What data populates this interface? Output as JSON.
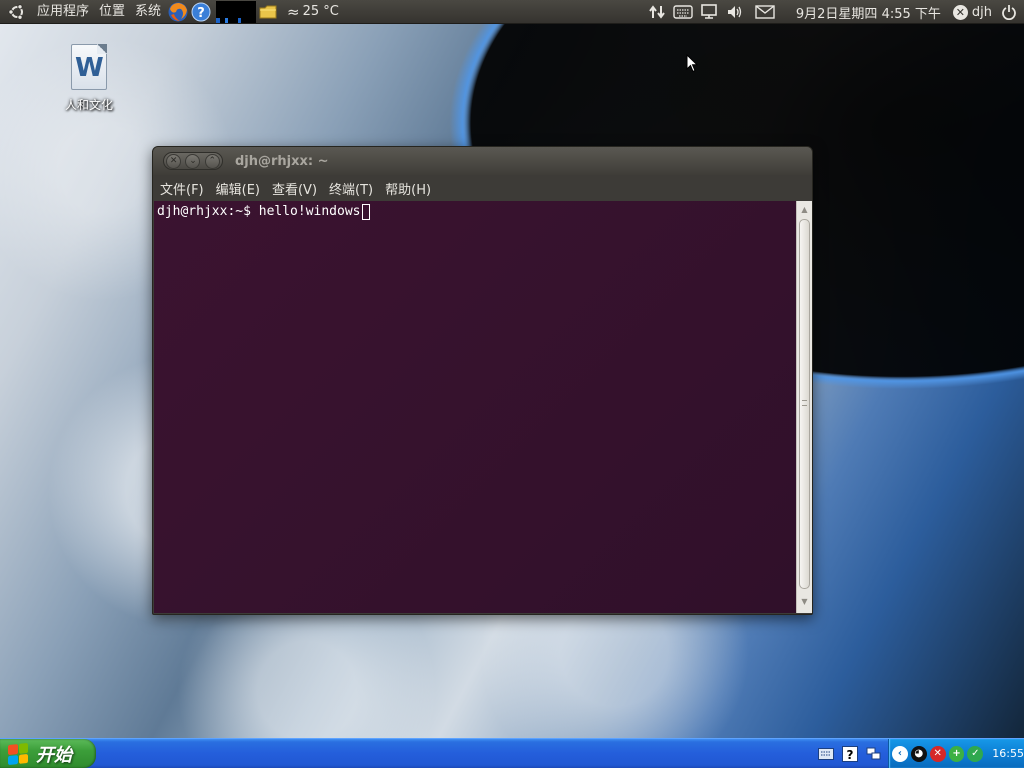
{
  "top_panel": {
    "menus": [
      "应用程序",
      "位置",
      "系统"
    ],
    "launchers": [
      "firefox-icon",
      "help-icon"
    ],
    "weather": {
      "icon": "≈",
      "temperature": "25 °C"
    },
    "indicators": [
      "network-arrows-icon",
      "keyboard-icon",
      "display-icon",
      "volume-icon",
      "mail-icon"
    ],
    "clock": "9月2日星期四  4:55 下午",
    "user": "djh",
    "power_icon": "power-icon"
  },
  "desktop": {
    "icons": [
      {
        "label": "人和文化",
        "icon": "word-document-icon"
      }
    ]
  },
  "terminal": {
    "title": "djh@rhjxx: ~",
    "menus": [
      "文件(F)",
      "编辑(E)",
      "查看(V)",
      "终端(T)",
      "帮助(H)"
    ],
    "prompt": "djh@rhjxx:~$ hello!windows",
    "colors": {
      "background": "#3b1330",
      "text": "#ffffff"
    }
  },
  "taskbar": {
    "start_label": "开始",
    "tray_time": "16:55",
    "colors": {
      "bar": "#245edb",
      "start": "#3c9e3a",
      "tray": "#0c7fd4"
    }
  }
}
